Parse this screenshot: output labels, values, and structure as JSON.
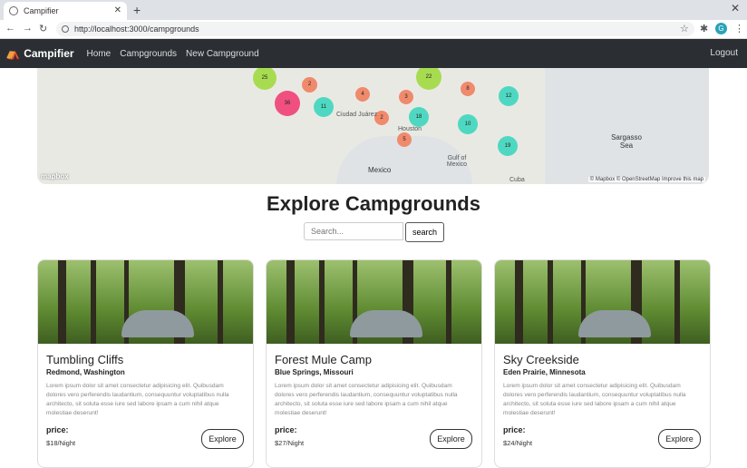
{
  "browser": {
    "tab_title": "Campifier",
    "url": "http://localhost:3000/campgrounds",
    "profile_initial": "G"
  },
  "navbar": {
    "brand": "Campifier",
    "links": [
      "Home",
      "Campgrounds",
      "New Campground"
    ],
    "logout": "Logout"
  },
  "map": {
    "clusters": [
      "25",
      "22",
      "2",
      "4",
      "3",
      "8",
      "12",
      "36",
      "11",
      "2",
      "18",
      "10",
      "5",
      "19"
    ],
    "labels": {
      "mexico": "Mexico",
      "gulf": "Gulf of Mexico",
      "sargasso": "Sargasso Sea",
      "cuba": "Cuba",
      "ciudad": "Ciudad Juárez",
      "houston": "Houston"
    },
    "logo": "mapbox",
    "attribution": "© Mapbox © OpenStreetMap Improve this map"
  },
  "page": {
    "title": "Explore Campgrounds",
    "search_placeholder": "Search...",
    "search_button": "search"
  },
  "campgrounds": [
    {
      "title": "Tumbling Cliffs",
      "location": "Redmond, Washington",
      "description": "Lorem ipsum dolor sit amet consectetur adipisicing elit. Quibusdam dolores vero perferendis laudantium, consequuntur voluptatibus nulla architecto, sit soluta esse iure sed labore ipsam a cum nihil atque molestiae deserunt!",
      "price_label": "price:",
      "price": "$18/Night",
      "button": "Explore"
    },
    {
      "title": "Forest Mule Camp",
      "location": "Blue Springs, Missouri",
      "description": "Lorem ipsum dolor sit amet consectetur adipisicing elit. Quibusdam dolores vero perferendis laudantium, consequuntur voluptatibus nulla architecto, sit soluta esse iure sed labore ipsam a cum nihil atque molestiae deserunt!",
      "price_label": "price:",
      "price": "$27/Night",
      "button": "Explore"
    },
    {
      "title": "Sky Creekside",
      "location": "Eden Prairie, Minnesota",
      "description": "Lorem ipsum dolor sit amet consectetur adipisicing elit. Quibusdam dolores vero perferendis laudantium, consequuntur voluptatibus nulla architecto, sit soluta esse iure sed labore ipsam a cum nihil atque molestiae deserunt!",
      "price_label": "price:",
      "price": "$24/Night",
      "button": "Explore"
    }
  ]
}
